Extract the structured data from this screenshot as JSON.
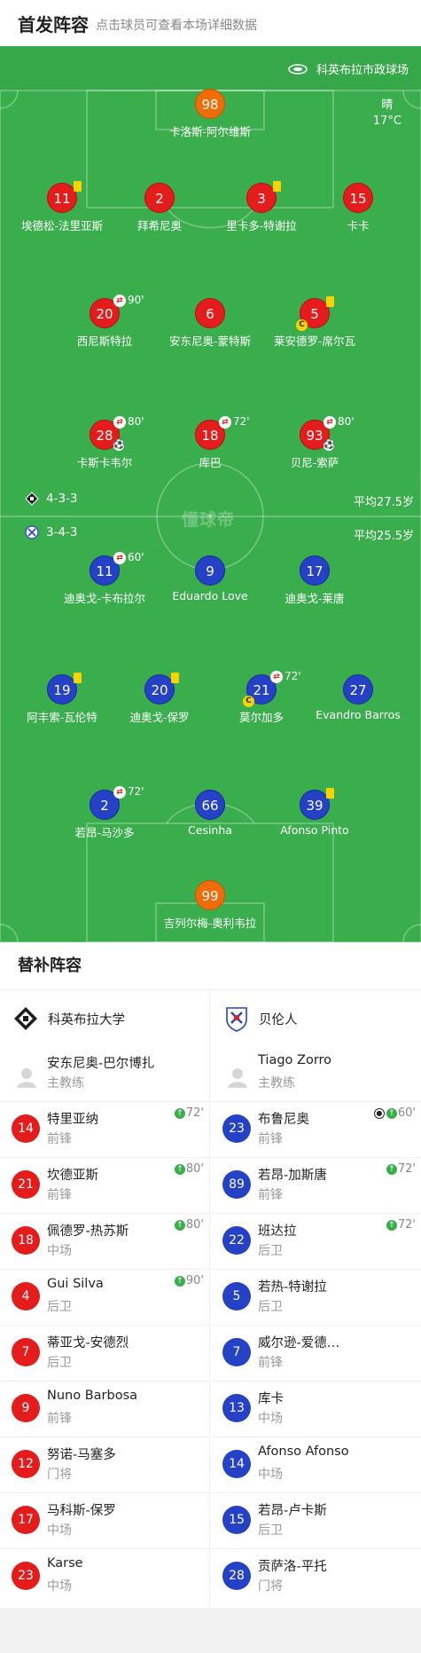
{
  "header": {
    "title": "首发阵容",
    "subtitle": "点击球员可查看本场详细数据"
  },
  "venue": {
    "stadium": "科英布拉市政球场",
    "weather": "晴",
    "temperature": "17°C"
  },
  "watermark": "懂球帝",
  "colors": {
    "pitch": "#3aae4d",
    "home": "#e51c1c",
    "away": "#2542c7",
    "goalkeeper": "#f06c08",
    "yellow_card": "#f7d400"
  },
  "home": {
    "formation": "4-3-3",
    "average_age": "平均27.5岁",
    "goalkeeper": {
      "number": "98",
      "name": "卡洛斯-阿尔维斯"
    },
    "defenders": [
      {
        "number": "11",
        "name": "埃德松-法里亚斯",
        "yellow": true
      },
      {
        "number": "2",
        "name": "拜希尼奥"
      },
      {
        "number": "3",
        "name": "里卡多-特谢拉",
        "yellow": true
      },
      {
        "number": "15",
        "name": "卡卡"
      }
    ],
    "midfielders": [
      {
        "number": "20",
        "name": "西尼斯特拉",
        "sub_time": "90'"
      },
      {
        "number": "6",
        "name": "安东尼奥-蒙特斯"
      },
      {
        "number": "5",
        "name": "莱安德罗-席尔瓦",
        "yellow": true,
        "captain": true
      }
    ],
    "forwards": [
      {
        "number": "28",
        "name": "卡斯卡韦尔",
        "sub_time": "80'",
        "goal": true
      },
      {
        "number": "18",
        "name": "库巴",
        "sub_time": "72'"
      },
      {
        "number": "93",
        "name": "贝尼-索萨",
        "sub_time": "80'",
        "goal": true
      }
    ]
  },
  "away": {
    "formation": "3-4-3",
    "average_age": "平均25.5岁",
    "forwards": [
      {
        "number": "11",
        "name": "迪奥戈-卡布拉尔",
        "sub_time": "60'"
      },
      {
        "number": "9",
        "name": "Eduardo Love"
      },
      {
        "number": "17",
        "name": "迪奥戈-莱唐"
      }
    ],
    "midfielders": [
      {
        "number": "19",
        "name": "阿丰索-瓦伦特",
        "yellow": true
      },
      {
        "number": "20",
        "name": "迪奥戈-保罗",
        "yellow": true
      },
      {
        "number": "21",
        "name": "莫尔加多",
        "sub_time": "72'",
        "captain": true
      },
      {
        "number": "27",
        "name": "Evandro Barros"
      }
    ],
    "defenders": [
      {
        "number": "2",
        "name": "若昂-马沙多",
        "sub_time": "72'"
      },
      {
        "number": "66",
        "name": "Cesinha"
      },
      {
        "number": "39",
        "name": "Afonso Pinto",
        "yellow": true
      }
    ],
    "goalkeeper": {
      "number": "99",
      "name": "吉列尔梅-奥利韦拉"
    }
  },
  "subs": {
    "title": "替补阵容",
    "home": {
      "team_name": "科英布拉大学",
      "coach": {
        "name": "安东尼奥-巴尔博扎",
        "role": "主教练"
      },
      "players": [
        {
          "number": "14",
          "name": "特里亚纳",
          "position": "前锋",
          "sub_in": "72'"
        },
        {
          "number": "21",
          "name": "坎德亚斯",
          "position": "前锋",
          "sub_in": "80'"
        },
        {
          "number": "18",
          "name": "佩德罗-热苏斯",
          "position": "中场",
          "sub_in": "80'"
        },
        {
          "number": "4",
          "name": "Gui Silva",
          "position": "后卫",
          "sub_in": "90'"
        },
        {
          "number": "7",
          "name": "蒂亚戈-安德烈",
          "position": "后卫"
        },
        {
          "number": "9",
          "name": "Nuno Barbosa",
          "position": "前锋"
        },
        {
          "number": "12",
          "name": "努诺-马塞多",
          "position": "门将"
        },
        {
          "number": "17",
          "name": "马科斯-保罗",
          "position": "中场"
        },
        {
          "number": "23",
          "name": "Karse",
          "position": "中场"
        }
      ]
    },
    "away": {
      "team_name": "贝伦人",
      "coach": {
        "name": "Tiago Zorro",
        "role": "主教练"
      },
      "players": [
        {
          "number": "23",
          "name": "布鲁尼奥",
          "position": "前锋",
          "sub_in": "60'",
          "goal": true
        },
        {
          "number": "89",
          "name": "若昂-加斯唐",
          "position": "前锋",
          "sub_in": "72'"
        },
        {
          "number": "22",
          "name": "班达拉",
          "position": "后卫",
          "sub_in": "72'"
        },
        {
          "number": "5",
          "name": "若热-特谢拉",
          "position": "后卫"
        },
        {
          "number": "7",
          "name": "威尔逊-爱德…",
          "position": "前锋"
        },
        {
          "number": "13",
          "name": "库卡",
          "position": "中场"
        },
        {
          "number": "14",
          "name": "Afonso Afonso",
          "position": "中场"
        },
        {
          "number": "15",
          "name": "若昂-卢卡斯",
          "position": "后卫"
        },
        {
          "number": "28",
          "name": "贡萨洛-平托",
          "position": "门将"
        }
      ]
    }
  }
}
